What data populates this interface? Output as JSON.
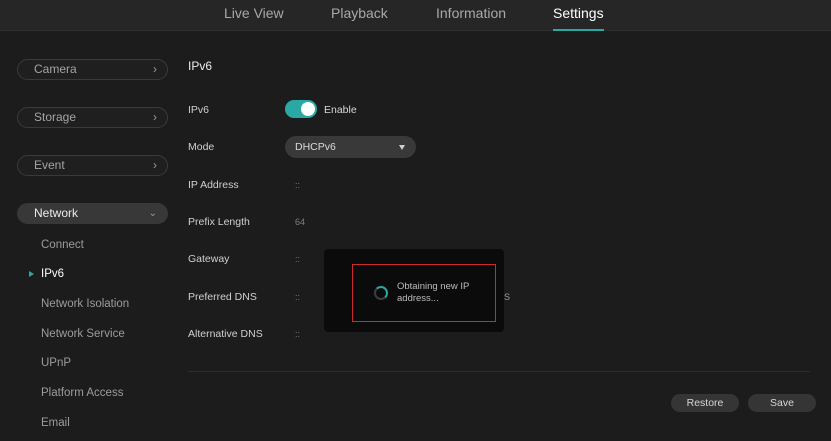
{
  "nav": {
    "tabs": [
      {
        "label": "Live View"
      },
      {
        "label": "Playback"
      },
      {
        "label": "Information"
      },
      {
        "label": "Settings"
      }
    ],
    "active_tab": "Settings"
  },
  "sidebar": {
    "groups": [
      {
        "label": "Camera"
      },
      {
        "label": "Storage"
      },
      {
        "label": "Event"
      },
      {
        "label": "Network"
      }
    ],
    "network_items": [
      {
        "label": "Connect"
      },
      {
        "label": "IPv6"
      },
      {
        "label": "Network Isolation"
      },
      {
        "label": "Network Service"
      },
      {
        "label": "UPnP"
      },
      {
        "label": "Platform Access"
      },
      {
        "label": "Email"
      }
    ],
    "active_item": "IPv6"
  },
  "main": {
    "section_title": "IPv6",
    "fields": {
      "ipv6": {
        "label": "IPv6",
        "toggle_label": "Enable",
        "enabled": true
      },
      "mode": {
        "label": "Mode",
        "value": "DHCPv6"
      },
      "ip_address": {
        "label": "IP Address",
        "value": "::"
      },
      "prefix_length": {
        "label": "Prefix Length",
        "value": "64"
      },
      "gateway": {
        "label": "Gateway",
        "value": "::"
      },
      "preferred_dns": {
        "label": "Preferred DNS",
        "value": "::"
      },
      "alternative_dns": {
        "label": "Alternative DNS",
        "value": "::"
      }
    },
    "buttons": {
      "restore": "Restore",
      "save": "Save"
    }
  },
  "overlay": {
    "message": "Obtaining new IP address...",
    "partial_text": "S"
  },
  "colors": {
    "accent": "#2aa8a3",
    "highlight_frame": "#cc2b2b",
    "background": "#1c1c1c"
  },
  "icons": [
    "chevron-right-icon",
    "chevron-down-icon",
    "dropdown-arrow-icon",
    "loading-spinner-icon"
  ]
}
